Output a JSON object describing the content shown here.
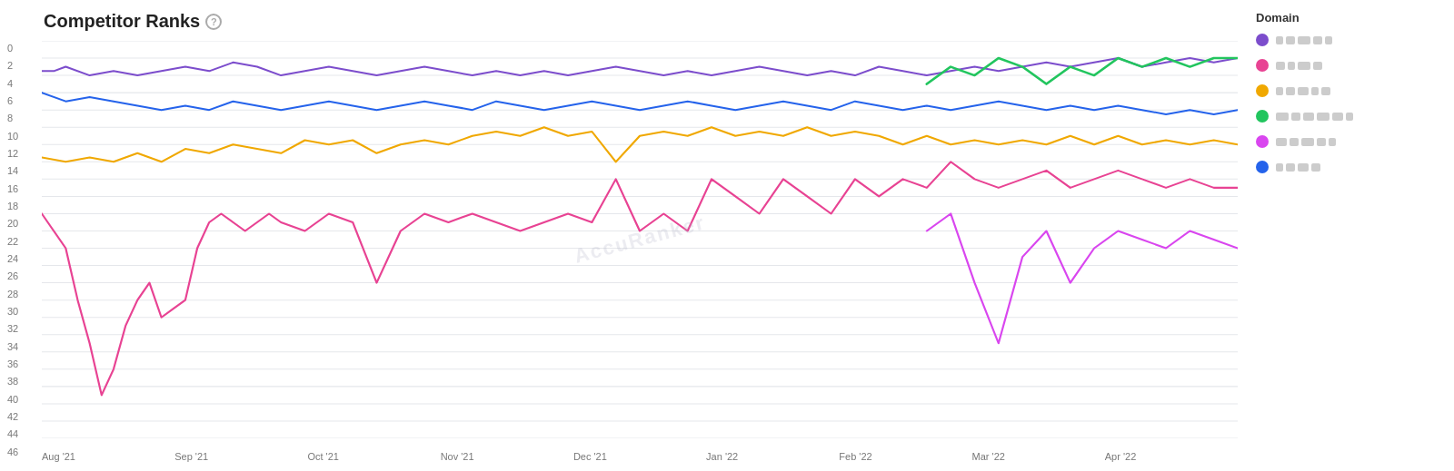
{
  "title": "Competitor Ranks",
  "help_icon_label": "?",
  "legend": {
    "title": "Domain",
    "items": [
      {
        "color": "#7c4dcc",
        "blocks": [
          8,
          10,
          14,
          10,
          8
        ]
      },
      {
        "color": "#e84393",
        "blocks": [
          10,
          8,
          14,
          10
        ]
      },
      {
        "color": "#f0a800",
        "blocks": [
          8,
          10,
          12,
          8,
          10
        ]
      },
      {
        "color": "#22c55e",
        "blocks": [
          14,
          10,
          12,
          14,
          12,
          8
        ]
      },
      {
        "color": "#d946ef",
        "blocks": [
          12,
          10,
          14,
          10,
          8
        ]
      },
      {
        "color": "#2563eb",
        "blocks": [
          8,
          10,
          12,
          10
        ]
      }
    ]
  },
  "y_axis": {
    "ticks": [
      "0",
      "2",
      "4",
      "6",
      "8",
      "10",
      "12",
      "14",
      "16",
      "18",
      "20",
      "22",
      "24",
      "26",
      "28",
      "30",
      "32",
      "34",
      "36",
      "38",
      "40",
      "42",
      "44",
      "46"
    ]
  },
  "x_axis": {
    "ticks": [
      "Aug '21",
      "Sep '21",
      "Oct '21",
      "Nov '21",
      "Dec '21",
      "Jan '22",
      "Feb '22",
      "Mar '22",
      "Apr '22"
    ]
  },
  "watermark": "AccuRanker"
}
